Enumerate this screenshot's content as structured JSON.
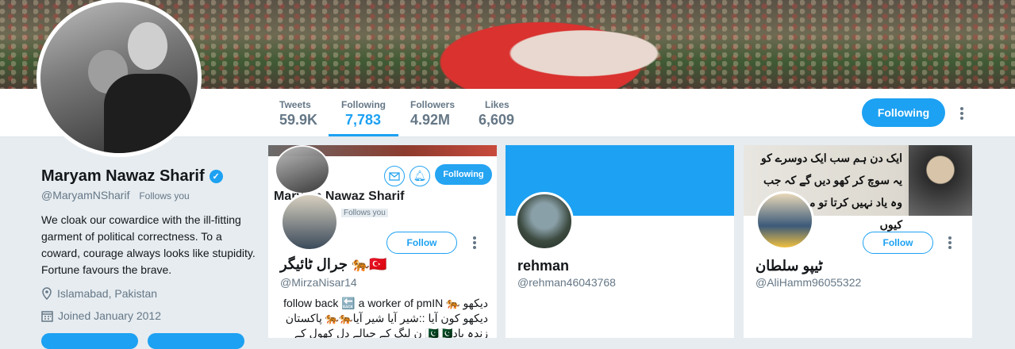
{
  "profile": {
    "name": "Maryam Nawaz Sharif",
    "handle": "@MaryamNSharif",
    "follows_you": "Follows you",
    "bio": "We cloak our cowardice with the ill-fitting garment of political correctness. To a coward, courage always looks like stupidity. Fortune favours the brave.",
    "location": "Islamabad, Pakistan",
    "joined": "Joined January 2012"
  },
  "stats": [
    {
      "label": "Tweets",
      "value": "59.9K"
    },
    {
      "label": "Following",
      "value": "7,783"
    },
    {
      "label": "Followers",
      "value": "4.92M"
    },
    {
      "label": "Likes",
      "value": "6,609"
    }
  ],
  "actions": {
    "following_label": "Following"
  },
  "cards": [
    {
      "name": "جرال ٹائیگر 🐅🇹🇷",
      "handle": "@MirzaNisar14",
      "follow_label": "Follow",
      "bio": "دیکھو 🐅 follow back 🔙 a worker of pmIN دیکھو کون آیا ::شیر آیا شیر آیا🐅🐅 پاکستان زندہ باد🇵🇰🇵🇰 ن لیگ کے جیالے دل کھول کے فالو کریں",
      "embedded": {
        "name": "Maryam Nawaz Sharif",
        "follows_you": "Follows you",
        "following_label": "Following"
      }
    },
    {
      "name": "rehman",
      "handle": "@rehman46043768",
      "accent": "#1da1f2"
    },
    {
      "name": "ٹیپو سلطان",
      "handle": "@AliHamm96055322",
      "follow_label": "Follow",
      "header_text": "ایک دن ہم سب ایک دوسرے کو یہ سوچ کر کھو دیں گے کہ جب وہ یاد نہیں کرتا تو میں اسے کیوں"
    }
  ],
  "icons": {
    "location": "map-pin-icon",
    "joined": "calendar-icon",
    "more": "more-vertical-icon",
    "verified": "verified-badge-icon"
  },
  "colors": {
    "accent": "#1da1f2",
    "muted": "#657786",
    "background": "#e6ecf0"
  }
}
